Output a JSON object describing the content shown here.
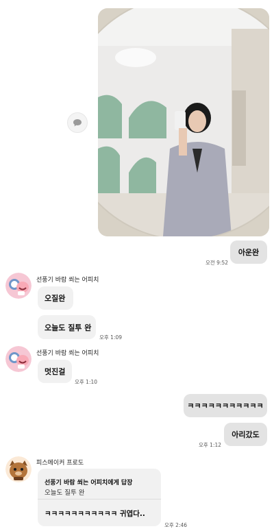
{
  "photo": {
    "description_icon": "photo"
  },
  "share_icon": "speech-bubble-icon",
  "messages": {
    "m1": {
      "text": "아운완",
      "time": "오전 9:52"
    },
    "sender1": "선풍기 바람 쐬는 어피치",
    "m2": {
      "text": "오질완"
    },
    "m3": {
      "text": "오늘도 질투 완",
      "time": "오후 1:09"
    },
    "sender2": "선풍기 바람 쐬는 어피치",
    "m4": {
      "text": "멋진걸",
      "time": "오후 1:10"
    },
    "m5": {
      "text": "ㅋㅋㅋㅋㅋㅋㅋㅋㅋㅋㅋ"
    },
    "m6": {
      "text": "아리갔도",
      "time": "오후 1:12"
    },
    "sender3": "피스메이커 프로도",
    "reply": {
      "title": "선풍기 바람 쐬는 어피치에게 답장",
      "quote": "오늘도 질투 완",
      "text": "ㅋㅋㅋㅋㅋㅋㅋㅋㅋㅋㅋ 귀엽다..",
      "time": "오후 2:46"
    }
  },
  "colors": {
    "my_bubble": "#e3e3e3",
    "their_bubble": "#f1f1f1",
    "apeach_pink": "#f6c7d4",
    "frodo_brown": "#b3743b"
  }
}
